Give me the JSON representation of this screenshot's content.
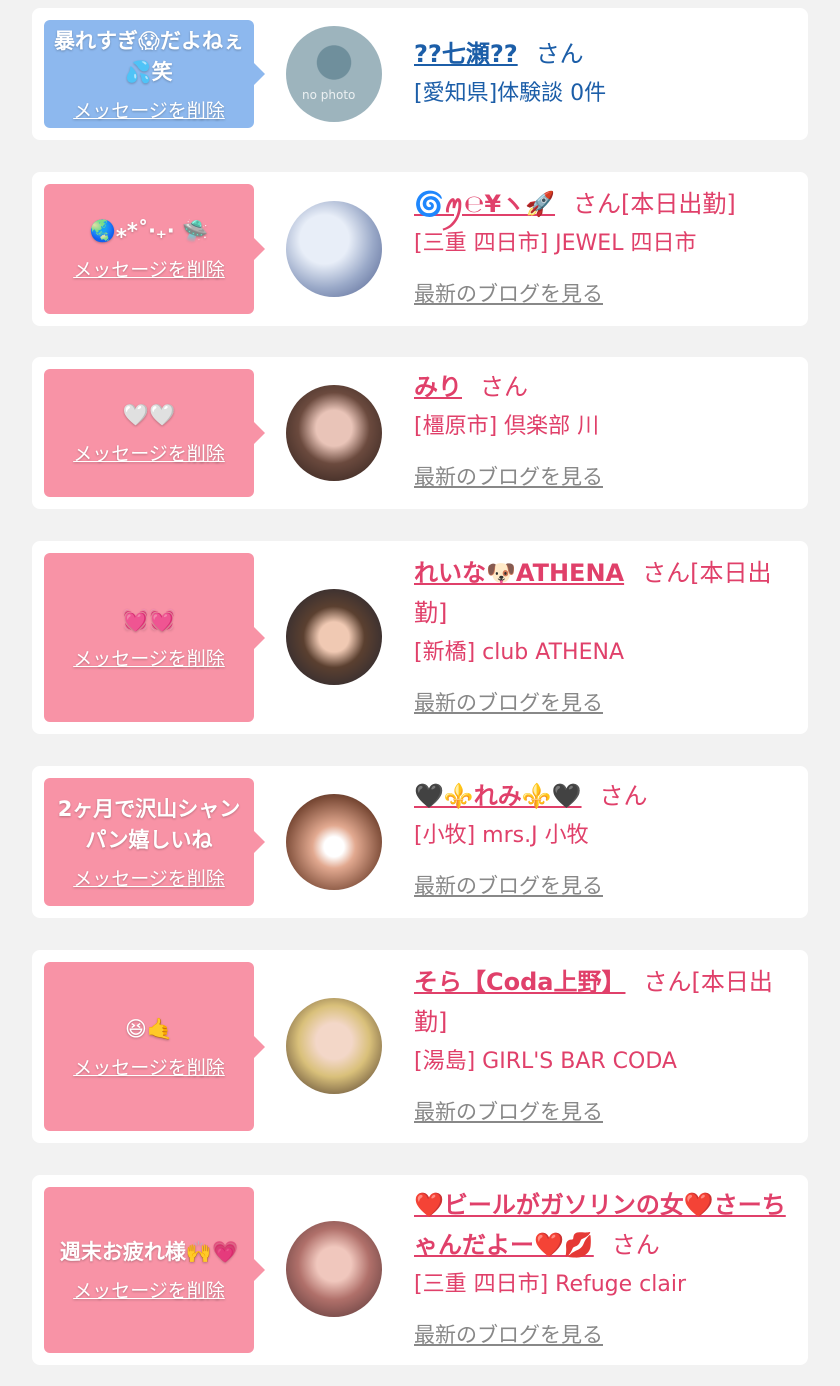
{
  "items": [
    {
      "message": "暴れすぎ😱だよねぇ💦笑",
      "delete_label": "メッセージを削除",
      "avatar_label": "no photo",
      "name": "??七瀬??",
      "suffix": "さん",
      "shop": "[愛知県]体験談 0件",
      "blog_label": ""
    },
    {
      "message": "🌏⁎*˚‧₊· 🛸",
      "delete_label": "メッセージを削除",
      "name": "🌀ꪑ℮¥ヽ🚀",
      "suffix": "さん[本日出勤]",
      "shop": "[三重 四日市] JEWEL 四日市",
      "blog_label": "最新のブログを見る"
    },
    {
      "message": "🤍🤍",
      "delete_label": "メッセージを削除",
      "name": "みり",
      "suffix": "さん",
      "shop": "[橿原市] 倶楽部 川",
      "blog_label": "最新のブログを見る"
    },
    {
      "message": "💓💓",
      "delete_label": "メッセージを削除",
      "name": "れいな🐶ATHENA",
      "suffix": "さん[本日出勤]",
      "shop": "[新橋] club ATHENA",
      "blog_label": "最新のブログを見る"
    },
    {
      "message": "2ヶ月で沢山シャンパン嬉しいね",
      "delete_label": "メッセージを削除",
      "name": "🖤⚜️れみ⚜️🖤",
      "suffix": "さん",
      "shop": "[小牧] mrs.J 小牧",
      "blog_label": "最新のブログを見る"
    },
    {
      "message": "😆🤙",
      "delete_label": "メッセージを削除",
      "name": "そら【Coda上野】",
      "suffix": "さん[本日出勤]",
      "shop": "[湯島] GIRL'S BAR CODA",
      "blog_label": "最新のブログを見る"
    },
    {
      "message": "週末お疲れ様🙌💗",
      "delete_label": "メッセージを削除",
      "name": "❤️ビールがガソリンの女❤️さーちゃんだよー❤️💋",
      "suffix": "さん",
      "shop": "[三重 四日市] Refuge clair",
      "blog_label": "最新のブログを見る"
    }
  ],
  "colors": {
    "pink_bubble": "#f893a6",
    "blue_bubble": "#8db8ee",
    "name_pink": "#e0406a",
    "name_blue": "#1c5ea8"
  }
}
